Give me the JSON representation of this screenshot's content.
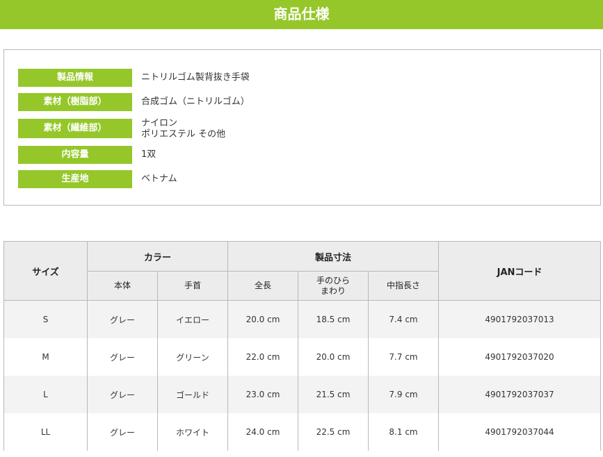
{
  "header": {
    "title": "商品仕様"
  },
  "info": [
    {
      "label": "製品情報",
      "value": "ニトリルゴム製背抜き手袋"
    },
    {
      "label": "素材（樹脂部）",
      "value": "合成ゴム（ニトリルゴム）"
    },
    {
      "label": "素材（繊維部）",
      "value": "ナイロン\nポリエステル その他"
    },
    {
      "label": "内容量",
      "value": "1双"
    },
    {
      "label": "生産地",
      "value": "ベトナム"
    }
  ],
  "table": {
    "headers": {
      "size": "サイズ",
      "color": "カラー",
      "dimensions": "製品寸法",
      "jan": "JANコード",
      "body": "本体",
      "cuff": "手首",
      "length": "全長",
      "palm": "手のひら\nまわり",
      "middle_finger": "中指長さ"
    },
    "rows": [
      {
        "size": "S",
        "body": "グレー",
        "cuff": "イエロー",
        "length": "20.0 cm",
        "palm": "18.5 cm",
        "finger": "7.4 cm",
        "jan": "4901792037013"
      },
      {
        "size": "M",
        "body": "グレー",
        "cuff": "グリーン",
        "length": "22.0 cm",
        "palm": "20.0 cm",
        "finger": "7.7 cm",
        "jan": "4901792037020"
      },
      {
        "size": "L",
        "body": "グレー",
        "cuff": "ゴールド",
        "length": "23.0 cm",
        "palm": "21.5 cm",
        "finger": "7.9 cm",
        "jan": "4901792037037"
      },
      {
        "size": "LL",
        "body": "グレー",
        "cuff": "ホワイト",
        "length": "24.0 cm",
        "palm": "22.5 cm",
        "finger": "8.1 cm",
        "jan": "4901792037044"
      }
    ]
  },
  "colors": {
    "accent": "#95c72a",
    "header_bg": "#ececec",
    "row_alt": "#f3f3f3",
    "border": "#b8b8b8"
  }
}
